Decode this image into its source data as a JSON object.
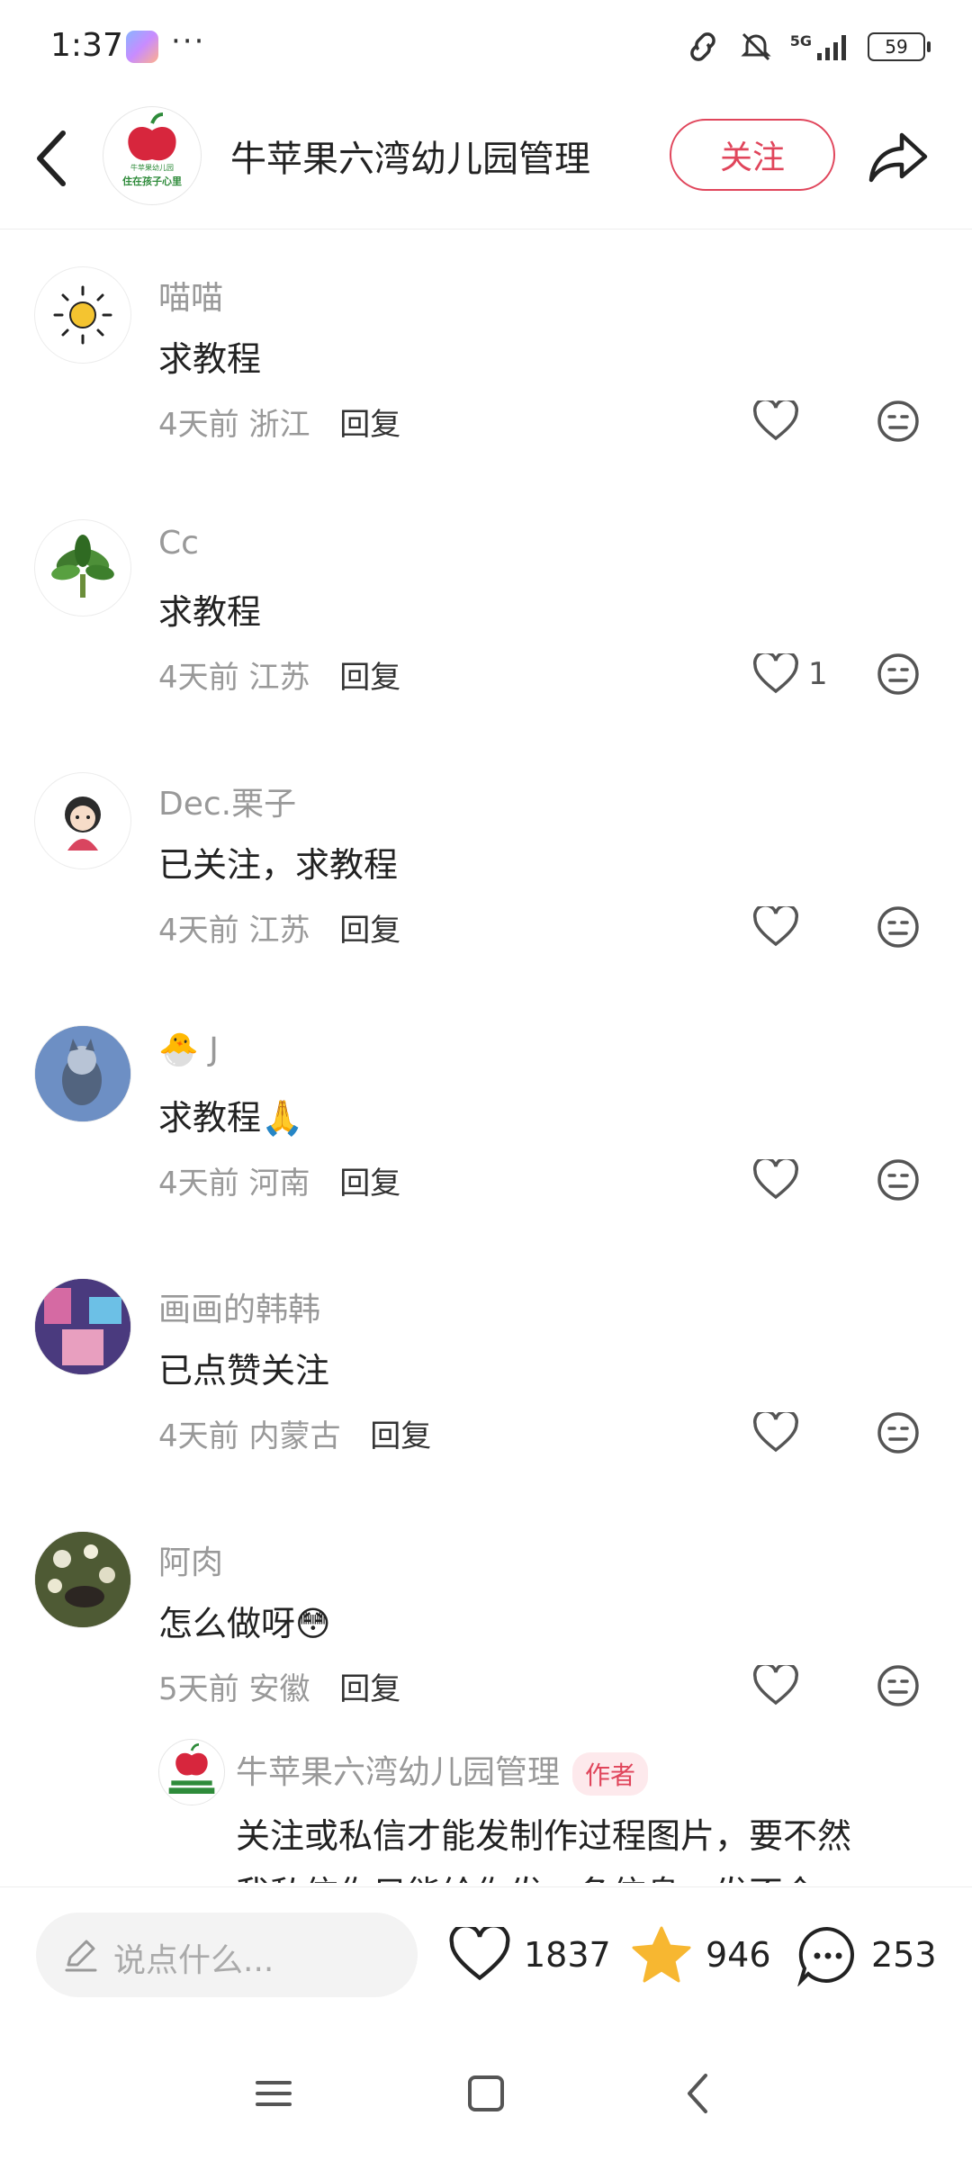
{
  "status": {
    "time": "1:37",
    "dots": "···",
    "network_label": "5G",
    "battery": "59"
  },
  "header": {
    "title": "牛苹果六湾幼儿园管理",
    "follow_label": "关注",
    "avatar_lines": [
      "牛苹果幼儿园",
      "住在孩子心里"
    ]
  },
  "comments": [
    {
      "name": "喵喵",
      "text": "求教程",
      "time": "4天前",
      "location": "浙江",
      "reply": "回复",
      "likes": ""
    },
    {
      "name": "Cc",
      "text": "求教程",
      "time": "4天前",
      "location": "江苏",
      "reply": "回复",
      "likes": "1"
    },
    {
      "name": "Dec.栗子",
      "text": "已关注，求教程",
      "time": "4天前",
      "location": "江苏",
      "reply": "回复",
      "likes": ""
    },
    {
      "name": "J",
      "name_emoji": "🐣",
      "text": "求教程",
      "text_emoji": "🙏",
      "time": "4天前",
      "location": "河南",
      "reply": "回复",
      "likes": ""
    },
    {
      "name": "画画的韩韩",
      "text": "已点赞关注",
      "time": "4天前",
      "location": "内蒙古",
      "reply": "回复",
      "likes": ""
    },
    {
      "name": "阿肉",
      "text": "怎么做呀",
      "text_emoji": "😳",
      "time": "5天前",
      "location": "安徽",
      "reply": "回复",
      "likes": ""
    }
  ],
  "author_reply": {
    "name": "牛苹果六湾幼儿园管理",
    "tag": "作者",
    "line1": "关注或私信才能发制作过程图片，要不然",
    "line2": "我私信你只能给你发一条信息，发不全"
  },
  "bottom": {
    "placeholder": "说点什么...",
    "likes": "1837",
    "stars": "946",
    "comments": "253"
  },
  "colors": {
    "accent": "#e0455b",
    "star": "#f7b731",
    "secondary_text": "#999999"
  }
}
